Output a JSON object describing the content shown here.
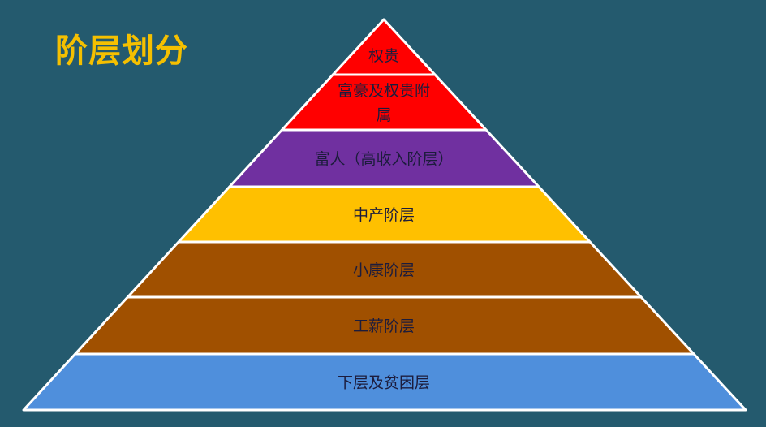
{
  "title": "阶层划分",
  "colors": {
    "background": "#245a6e",
    "title": "#f5c000",
    "outline": "#ffffff"
  },
  "pyramid": {
    "layers": [
      {
        "lines": [
          "权贵"
        ],
        "color": "#ff0000"
      },
      {
        "lines": [
          "富豪及权贵附",
          "属"
        ],
        "color": "#ff0000"
      },
      {
        "lines": [
          "富人（高收入阶层）"
        ],
        "color": "#7030a0"
      },
      {
        "lines": [
          "中产阶层"
        ],
        "color": "#ffc000"
      },
      {
        "lines": [
          "小康阶层"
        ],
        "color": "#a05000"
      },
      {
        "lines": [
          "工薪阶层"
        ],
        "color": "#a05000"
      },
      {
        "lines": [
          "下层及贫困层"
        ],
        "color": "#4f8fdc"
      }
    ]
  }
}
